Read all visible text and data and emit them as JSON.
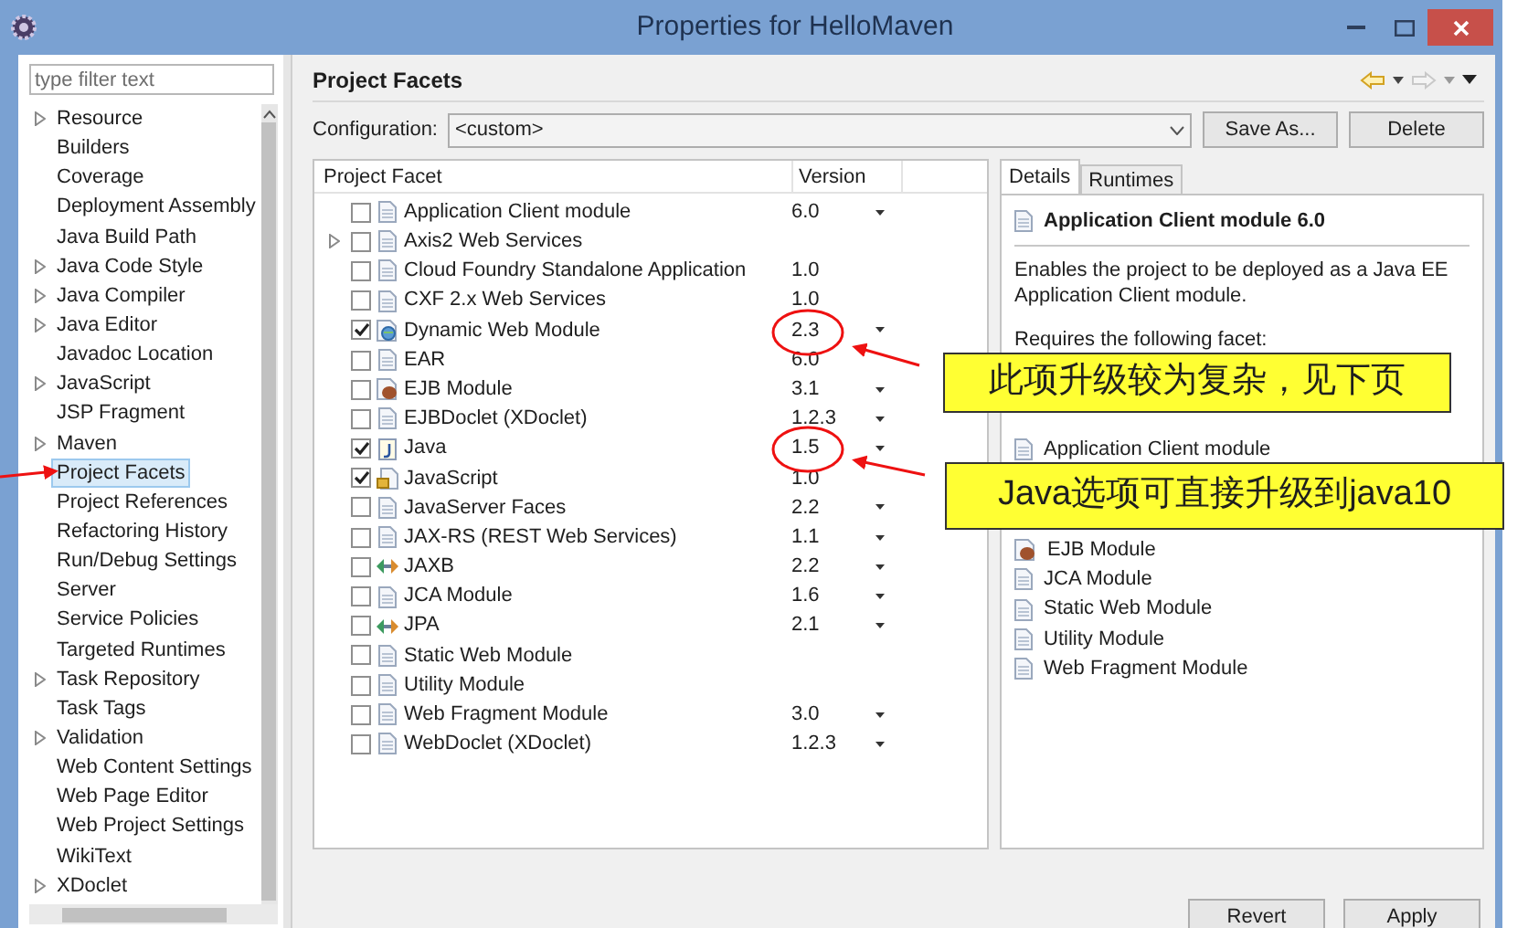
{
  "window": {
    "title": "Properties for HelloMaven"
  },
  "sidebar": {
    "filter_placeholder": "type filter text",
    "items": [
      {
        "label": "Resource",
        "expandable": true,
        "selected": false
      },
      {
        "label": "Builders",
        "expandable": false,
        "selected": false
      },
      {
        "label": "Coverage",
        "expandable": false,
        "selected": false
      },
      {
        "label": "Deployment Assembly",
        "expandable": false,
        "selected": false
      },
      {
        "label": "Java Build Path",
        "expandable": false,
        "selected": false
      },
      {
        "label": "Java Code Style",
        "expandable": true,
        "selected": false
      },
      {
        "label": "Java Compiler",
        "expandable": true,
        "selected": false
      },
      {
        "label": "Java Editor",
        "expandable": true,
        "selected": false
      },
      {
        "label": "Javadoc Location",
        "expandable": false,
        "selected": false
      },
      {
        "label": "JavaScript",
        "expandable": true,
        "selected": false
      },
      {
        "label": "JSP Fragment",
        "expandable": false,
        "selected": false
      },
      {
        "label": "Maven",
        "expandable": true,
        "selected": false
      },
      {
        "label": "Project Facets",
        "expandable": false,
        "selected": true
      },
      {
        "label": "Project References",
        "expandable": false,
        "selected": false
      },
      {
        "label": "Refactoring History",
        "expandable": false,
        "selected": false
      },
      {
        "label": "Run/Debug Settings",
        "expandable": false,
        "selected": false
      },
      {
        "label": "Server",
        "expandable": false,
        "selected": false
      },
      {
        "label": "Service Policies",
        "expandable": false,
        "selected": false
      },
      {
        "label": "Targeted Runtimes",
        "expandable": false,
        "selected": false
      },
      {
        "label": "Task Repository",
        "expandable": true,
        "selected": false
      },
      {
        "label": "Task Tags",
        "expandable": false,
        "selected": false
      },
      {
        "label": "Validation",
        "expandable": true,
        "selected": false
      },
      {
        "label": "Web Content Settings",
        "expandable": false,
        "selected": false
      },
      {
        "label": "Web Page Editor",
        "expandable": false,
        "selected": false
      },
      {
        "label": "Web Project Settings",
        "expandable": false,
        "selected": false
      },
      {
        "label": "WikiText",
        "expandable": false,
        "selected": false
      },
      {
        "label": "XDoclet",
        "expandable": true,
        "selected": false
      }
    ]
  },
  "page": {
    "title": "Project Facets",
    "configuration_label": "Configuration:",
    "configuration_value": "<custom>",
    "buttons": [
      "Save As...",
      "Delete"
    ]
  },
  "table": {
    "columns": [
      "Project Facet",
      "Version"
    ],
    "rows": [
      {
        "name": "Application Client module",
        "version": "6.0",
        "dropdown": true,
        "checked": false,
        "expandable": false,
        "kind": "document"
      },
      {
        "name": "Axis2 Web Services",
        "dropdown": false,
        "checked": false,
        "expandable": true,
        "kind": "document"
      },
      {
        "name": "Cloud Foundry Standalone Application",
        "version": "1.0",
        "dropdown": false,
        "checked": false,
        "expandable": false,
        "kind": "document"
      },
      {
        "name": "CXF 2.x Web Services",
        "version": "1.0",
        "dropdown": false,
        "checked": false,
        "expandable": false,
        "kind": "document"
      },
      {
        "name": "Dynamic Web Module",
        "version": "2.3",
        "dropdown": true,
        "checked": true,
        "expandable": false,
        "kind": "web"
      },
      {
        "name": "EAR",
        "version": "6.0",
        "dropdown": false,
        "checked": false,
        "expandable": false,
        "kind": "document"
      },
      {
        "name": "EJB Module",
        "version": "3.1",
        "dropdown": true,
        "checked": false,
        "expandable": false,
        "kind": "bean"
      },
      {
        "name": "EJBDoclet (XDoclet)",
        "version": "1.2.3",
        "dropdown": true,
        "checked": false,
        "expandable": false,
        "kind": "document"
      },
      {
        "name": "Java",
        "version": "1.5",
        "dropdown": true,
        "checked": true,
        "expandable": false,
        "kind": "java"
      },
      {
        "name": "JavaScript",
        "version": "1.0",
        "dropdown": false,
        "checked": true,
        "expandable": false,
        "kind": "script"
      },
      {
        "name": "JavaServer Faces",
        "version": "2.2",
        "dropdown": true,
        "checked": false,
        "expandable": false,
        "kind": "document"
      },
      {
        "name": "JAX-RS (REST Web Services)",
        "version": "1.1",
        "dropdown": true,
        "checked": false,
        "expandable": false,
        "kind": "document"
      },
      {
        "name": "JAXB",
        "version": "2.2",
        "dropdown": true,
        "checked": false,
        "expandable": false,
        "kind": "binding"
      },
      {
        "name": "JCA Module",
        "version": "1.6",
        "dropdown": true,
        "checked": false,
        "expandable": false,
        "kind": "document"
      },
      {
        "name": "JPA",
        "version": "2.1",
        "dropdown": true,
        "checked": false,
        "expandable": false,
        "kind": "binding"
      },
      {
        "name": "Static Web Module",
        "dropdown": false,
        "checked": false,
        "expandable": false,
        "kind": "document"
      },
      {
        "name": "Utility Module",
        "dropdown": false,
        "checked": false,
        "expandable": false,
        "kind": "document"
      },
      {
        "name": "Web Fragment Module",
        "version": "3.0",
        "dropdown": true,
        "checked": false,
        "expandable": false,
        "kind": "document"
      },
      {
        "name": "WebDoclet (XDoclet)",
        "version": "1.2.3",
        "dropdown": true,
        "checked": false,
        "expandable": false,
        "kind": "document"
      }
    ]
  },
  "details": {
    "tabs": [
      {
        "label": "Details",
        "selected": true
      },
      {
        "label": "Runtimes",
        "selected": false
      }
    ],
    "heading": "Application Client module 6.0",
    "description": "Enables the project to be deployed as a Java EE Application Client module.",
    "requires_label": "Requires the following facet:",
    "conflicts_top": [
      {
        "name": "Application Client module",
        "kind": "document"
      }
    ],
    "conflicts": [
      {
        "name": "EJB Module",
        "kind": "bean"
      },
      {
        "name": "JCA Module",
        "kind": "document"
      },
      {
        "name": "Static Web Module",
        "kind": "document"
      },
      {
        "name": "Utility Module",
        "kind": "document"
      },
      {
        "name": "Web Fragment Module",
        "kind": "document"
      }
    ]
  },
  "footer_buttons": [
    "Revert",
    "Apply"
  ],
  "annotations": [
    {
      "text": "此项升级较为复杂，见下页"
    },
    {
      "text": "Java选项可直接升级到java10"
    }
  ]
}
